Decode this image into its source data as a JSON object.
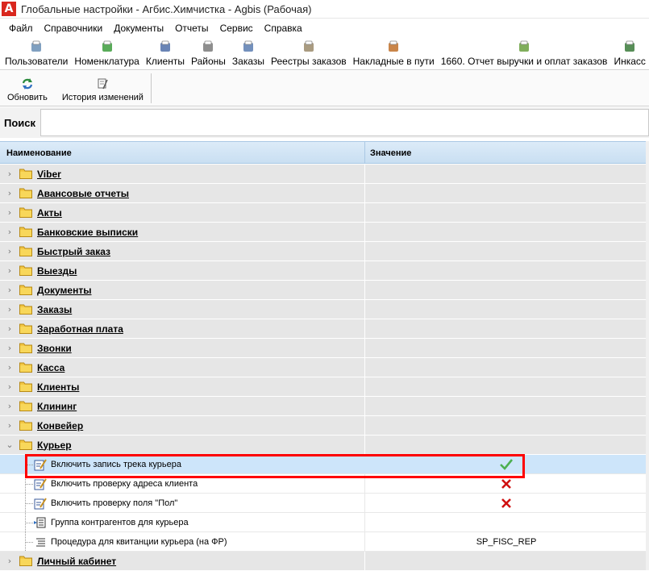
{
  "window": {
    "title": "Глобальные настройки - Агбис.Химчистка - Agbis (Рабочая)",
    "logo_letter": "A"
  },
  "menu": [
    "Файл",
    "Справочники",
    "Документы",
    "Отчеты",
    "Сервис",
    "Справка"
  ],
  "toolbar": [
    {
      "label": "Пользователи",
      "icon": "users-icon"
    },
    {
      "label": "Номенклатура",
      "icon": "nomenclature-icon"
    },
    {
      "label": "Клиенты",
      "icon": "client-icon"
    },
    {
      "label": "Районы",
      "icon": "districts-icon"
    },
    {
      "label": "Заказы",
      "icon": "orders-icon"
    },
    {
      "label": "Реестры заказов",
      "icon": "order-registry-icon"
    },
    {
      "label": "Накладные в пути",
      "icon": "waybill-icon"
    },
    {
      "label": "1660. Отчет выручки и оплат заказов",
      "icon": "report-icon"
    },
    {
      "label": "Инкасс",
      "icon": "collection-icon"
    }
  ],
  "subtoolbar": {
    "refresh_label": "Обновить",
    "history_label": "История изменений"
  },
  "search": {
    "label": "Поиск",
    "value": ""
  },
  "grid": {
    "col_name": "Наименование",
    "col_value": "Значение",
    "groups_before": [
      "Viber",
      "Авансовые отчеты",
      "Акты",
      "Банковские выписки",
      "Быстрый заказ",
      "Выезды",
      "Документы",
      "Заказы",
      "Заработная плата",
      "Звонки",
      "Касса",
      "Клиенты",
      "Клининг",
      "Конвейер"
    ],
    "expanded_group": "Курьер",
    "children": [
      {
        "label": "Включить запись трека курьера",
        "value_type": "check",
        "icon": "setting-edit-icon",
        "selected": true
      },
      {
        "label": "Включить проверку адреса клиента",
        "value_type": "cross",
        "icon": "setting-edit-icon"
      },
      {
        "label": "Включить проверку поля \"Пол\"",
        "value_type": "cross",
        "icon": "setting-edit-icon"
      },
      {
        "label": "Группа контрагентов для курьера",
        "value_type": "none",
        "icon": "group-list-icon"
      },
      {
        "label": "Процедура для квитанции курьера (на ФР)",
        "value_type": "text",
        "value": "SP_FISC_REP",
        "icon": "procedure-icon"
      }
    ],
    "groups_after": [
      "Личный кабинет"
    ]
  },
  "colors": {
    "header_bg": "#c9dff2",
    "selected_row": "#cde5fa",
    "group_row": "#e6e6e6",
    "highlight": "#ff0000",
    "check": "#4caf50",
    "cross": "#d01010"
  }
}
